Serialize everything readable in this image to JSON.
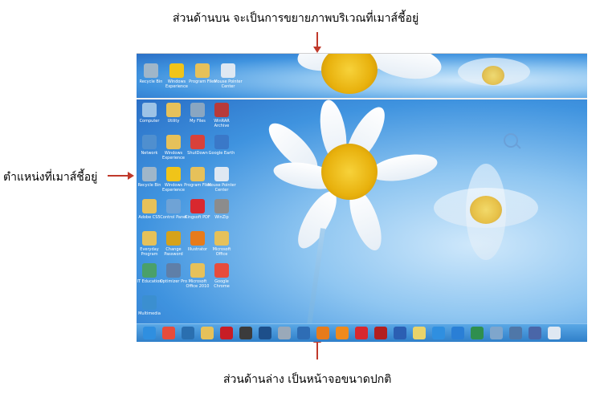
{
  "captions": {
    "top": "ส่วนด้านบน จะเป็นการขยายภาพบริเวณที่เมาส์ชี้อยู่",
    "left": "ตำแหน่งที่เมาส์ชี้อยู่",
    "bottom": "ส่วนด้านล่าง เป็นหน้าจอขนาดปกติ"
  },
  "magnifier_icons": [
    {
      "label": "Recycle Bin",
      "icon": "recycle-bin-icon",
      "color": "#9fb6c9"
    },
    {
      "label": "Windows Experience",
      "icon": "star-icon",
      "color": "#f0c419"
    },
    {
      "label": "Program Files",
      "icon": "folder-icon",
      "color": "#e6c15a"
    },
    {
      "label": "Mouse Pointer Center",
      "icon": "headset-icon",
      "color": "#dfe8f2"
    }
  ],
  "desktop_icons": [
    {
      "label": "Computer",
      "icon": "computer-icon",
      "color": "#9dc3e6"
    },
    {
      "label": "Utility",
      "icon": "folder-icon",
      "color": "#e6c15a"
    },
    {
      "label": "My Files",
      "icon": "users-icon",
      "color": "#8aa6c1"
    },
    {
      "label": "WinRAR Archive",
      "icon": "archive-icon",
      "color": "#b83a3a"
    },
    {
      "label": "Network",
      "icon": "network-icon",
      "color": "#4f8fcf"
    },
    {
      "label": "Windows Experience",
      "icon": "folder-icon",
      "color": "#e6c15a"
    },
    {
      "label": "ShutDown",
      "icon": "power-icon",
      "color": "#d9413a"
    },
    {
      "label": "Google Earth",
      "icon": "globe-icon",
      "color": "#3a78c8"
    },
    {
      "label": "Recycle Bin",
      "icon": "recycle-bin-icon",
      "color": "#9fb6c9"
    },
    {
      "label": "Windows Experience",
      "icon": "star-icon",
      "color": "#f0c419"
    },
    {
      "label": "Program Files",
      "icon": "folder-icon",
      "color": "#e6c15a"
    },
    {
      "label": "Mouse Pointer Center",
      "icon": "headset-icon",
      "color": "#dfe8f2"
    },
    {
      "label": "Adobe CS5",
      "icon": "folder-icon",
      "color": "#e6c15a"
    },
    {
      "label": "Control Panel",
      "icon": "control-panel-icon",
      "color": "#6fa3d6"
    },
    {
      "label": "Kingsoft PDF",
      "icon": "k-app-icon",
      "color": "#d8282f"
    },
    {
      "label": "WinZip",
      "icon": "winzip-icon",
      "color": "#8c8c8c"
    },
    {
      "label": "Everyday Program",
      "icon": "folder-icon",
      "color": "#e6c15a"
    },
    {
      "label": "Change Password",
      "icon": "keys-icon",
      "color": "#d6a21a"
    },
    {
      "label": "Illustrator",
      "icon": "illustrator-icon",
      "color": "#e77b1b"
    },
    {
      "label": "Microsoft Office",
      "icon": "folder-icon",
      "color": "#e6c15a"
    },
    {
      "label": "IT Education",
      "icon": "network-drive-icon",
      "color": "#4aa06a"
    },
    {
      "label": "Optimizer Pro",
      "icon": "tools-icon",
      "color": "#5f7fa8"
    },
    {
      "label": "Microsoft Office 2010",
      "icon": "folder-icon",
      "color": "#e6c15a"
    },
    {
      "label": "Google Chrome",
      "icon": "chrome-icon",
      "color": "#e74c3c"
    },
    {
      "label": "Multimedia",
      "icon": "media-icon",
      "color": "#3b8fd0"
    }
  ],
  "taskbar_icons": [
    {
      "icon": "ie-icon",
      "color": "#2f8fe0"
    },
    {
      "icon": "chrome-icon",
      "color": "#e74c3c"
    },
    {
      "icon": "whale-icon",
      "color": "#2a6fb0"
    },
    {
      "icon": "folder-icon",
      "color": "#e6c15a"
    },
    {
      "icon": "red-app-icon",
      "color": "#c81d25"
    },
    {
      "icon": "movie-icon",
      "color": "#3b3b3b"
    },
    {
      "icon": "photoshop-icon",
      "color": "#1d4f8a"
    },
    {
      "icon": "printer-icon",
      "color": "#9aa9b9"
    },
    {
      "icon": "network-icon",
      "color": "#2e6db5"
    },
    {
      "icon": "illustrator-icon",
      "color": "#e77b1b"
    },
    {
      "icon": "vlc-icon",
      "color": "#f08a1c"
    },
    {
      "icon": "k-app-icon",
      "color": "#d8282f"
    },
    {
      "icon": "x-app-icon",
      "color": "#b21f1f"
    },
    {
      "icon": "word-icon",
      "color": "#2b5fb3"
    },
    {
      "icon": "notes-icon",
      "color": "#e9d36a"
    },
    {
      "icon": "ie-icon",
      "color": "#2f8fe0"
    },
    {
      "icon": "globe-icon",
      "color": "#2a7fd6"
    },
    {
      "icon": "media-icon",
      "color": "#2f8f4e"
    },
    {
      "icon": "computer-icon",
      "color": "#7fa6cc"
    },
    {
      "icon": "settings-icon",
      "color": "#4f77a8"
    },
    {
      "icon": "shield-icon",
      "color": "#4a66a8"
    },
    {
      "icon": "keyboard-icon",
      "color": "#dfe8f2"
    }
  ],
  "accent_color": "#c0392b"
}
